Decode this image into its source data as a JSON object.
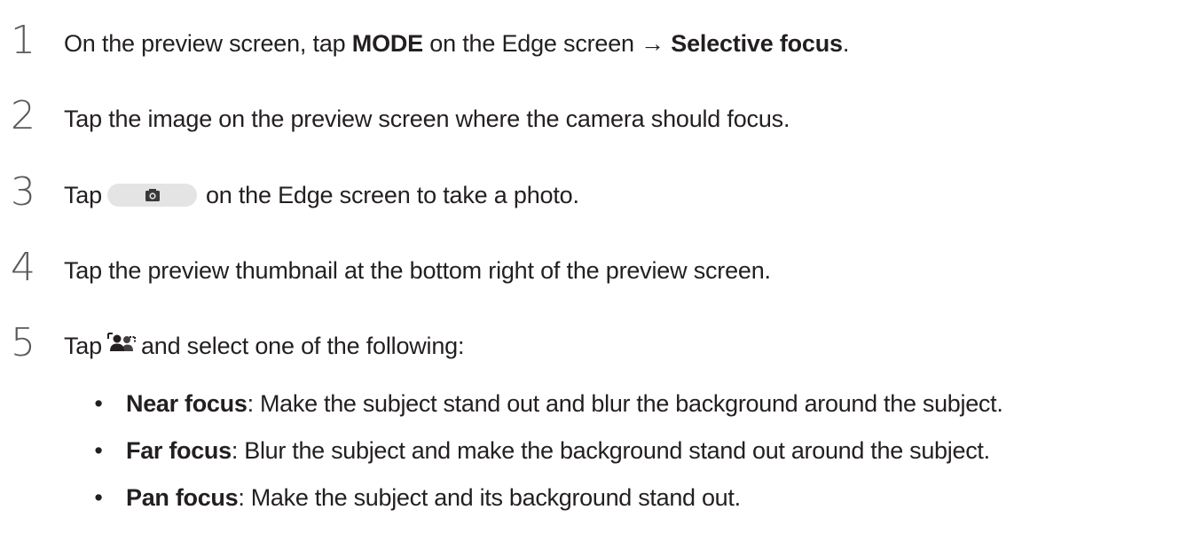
{
  "steps": [
    {
      "number": "1",
      "text_a": "On the preview screen, tap ",
      "bold_a": "MODE",
      "text_b": " on the Edge screen → ",
      "bold_b": "Selective focus",
      "text_c": "."
    },
    {
      "number": "2",
      "text": "Tap the image on the preview screen where the camera should focus."
    },
    {
      "number": "3",
      "text_a": "Tap",
      "text_b": "on the Edge screen to take a photo.",
      "icon": "camera-icon"
    },
    {
      "number": "4",
      "text": "Tap the preview thumbnail at the bottom right of the preview screen."
    },
    {
      "number": "5",
      "text_a": "Tap",
      "text_b": "and select one of the following:",
      "icon": "selective-focus-people-icon"
    }
  ],
  "options": [
    {
      "bullet": "•",
      "term": "Near focus",
      "description": ": Make the subject stand out and blur the background around the subject."
    },
    {
      "bullet": "•",
      "term": "Far focus",
      "description": ": Blur the subject and make the background stand out around the subject."
    },
    {
      "bullet": "•",
      "term": "Pan focus",
      "description": ": Make the subject and its background stand out."
    }
  ],
  "colors": {
    "text": "#231f20",
    "step_number": "#5a5a5a",
    "button_bg": "#e4e4e4"
  }
}
